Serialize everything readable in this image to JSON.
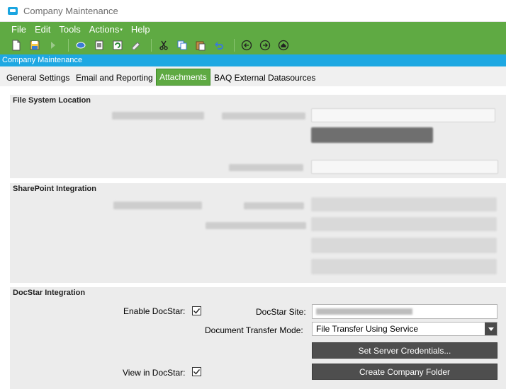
{
  "window": {
    "title": "Company Maintenance"
  },
  "menubar": {
    "items": [
      {
        "label": "File"
      },
      {
        "label": "Edit"
      },
      {
        "label": "Tools"
      },
      {
        "label": "Actions",
        "caret": "▾"
      },
      {
        "label": "Help"
      }
    ]
  },
  "toolbar": {
    "icons": [
      "new-icon",
      "save-icon",
      "forward-icon",
      "attach-icon",
      "print-icon",
      "refresh-icon",
      "clear-icon",
      "cut-icon",
      "copy-icon",
      "paste-icon",
      "undo-icon",
      "back-arrow-icon",
      "forward-arrow-icon",
      "home-icon"
    ]
  },
  "subtitle": "Company Maintenance",
  "tabs": [
    {
      "label": "General Settings"
    },
    {
      "label": "Email and Reporting"
    },
    {
      "label": "Attachments",
      "active": true
    },
    {
      "label": "BAQ External Datasources"
    }
  ],
  "groups": {
    "file_system": {
      "title": "File System Location"
    },
    "sharepoint": {
      "title": "SharePoint Integration"
    },
    "docstar": {
      "title": "DocStar Integration",
      "enable_label": "Enable DocStar:",
      "enable_checked": true,
      "site_label": "DocStar Site:",
      "transfer_label": "Document Transfer Mode:",
      "transfer_value": "File Transfer Using Service",
      "set_credentials_label": "Set Server Credentials...",
      "view_label": "View in DocStar:",
      "view_checked": true,
      "create_folder_label": "Create Company Folder"
    }
  },
  "colors": {
    "accent_green": "#5faa43",
    "title_blue": "#1ea8e2",
    "button_dark": "#4e4e4e"
  }
}
